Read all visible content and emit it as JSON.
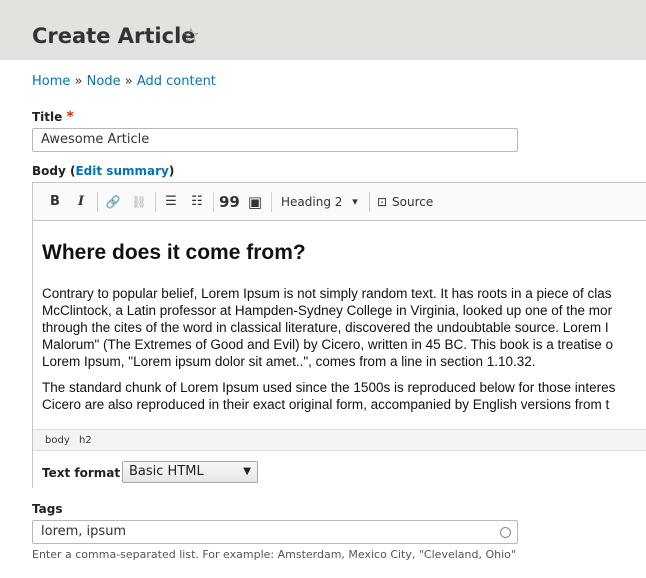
{
  "header": {
    "title": "Create Article",
    "star_glyph": "☆"
  },
  "breadcrumb": {
    "items": [
      "Home",
      "Node",
      "Add content"
    ],
    "separator": "»"
  },
  "title_field": {
    "label": "Title",
    "required_mark": "*",
    "value": "Awesome Article"
  },
  "body_field": {
    "label": "Body",
    "edit_summary": "Edit summary",
    "paren_open": "(",
    "paren_close": ")"
  },
  "toolbar": {
    "bold": "B",
    "italic": "I",
    "link_icon": "🔗",
    "unlink_icon": "⛓",
    "bullet_icon": "☰",
    "numbered_icon": "☷",
    "quote_icon": "99",
    "image_icon": "▣",
    "heading_select": "Heading 2",
    "heading_arrow": "▾",
    "source_icon": "⊡",
    "source_label": "Source"
  },
  "content": {
    "heading": "Where does it come from?",
    "para1": [
      "Contrary to popular belief, Lorem Ipsum is not simply random text. It has roots in a piece of clas",
      "McClintock, a Latin professor at Hampden-Sydney College in Virginia, looked up one of the mor",
      "through the cites of the word in classical literature, discovered the undoubtable source. Lorem I",
      "Malorum\" (The Extremes of Good and Evil) by Cicero, written in 45 BC. This book is a treatise o",
      "Lorem Ipsum, \"Lorem ipsum dolor sit amet..\", comes from a line in section 1.10.32."
    ],
    "para2": [
      "The standard chunk of Lorem Ipsum used since the 1500s is reproduced below for those interes",
      "Cicero are also reproduced in their exact original form, accompanied by English versions from t"
    ]
  },
  "element_path": [
    "body",
    "h2"
  ],
  "text_format": {
    "label": "Text format",
    "selected": "Basic HTML",
    "arrow": "▼"
  },
  "tags_field": {
    "label": "Tags",
    "value": "lorem, ipsum",
    "help": "Enter a comma-separated list. For example: Amsterdam, Mexico City, \"Cleveland, Ohio\""
  },
  "colors": {
    "link": "#0074bd",
    "required": "#e32700",
    "header_bg": "#e3e2de"
  }
}
